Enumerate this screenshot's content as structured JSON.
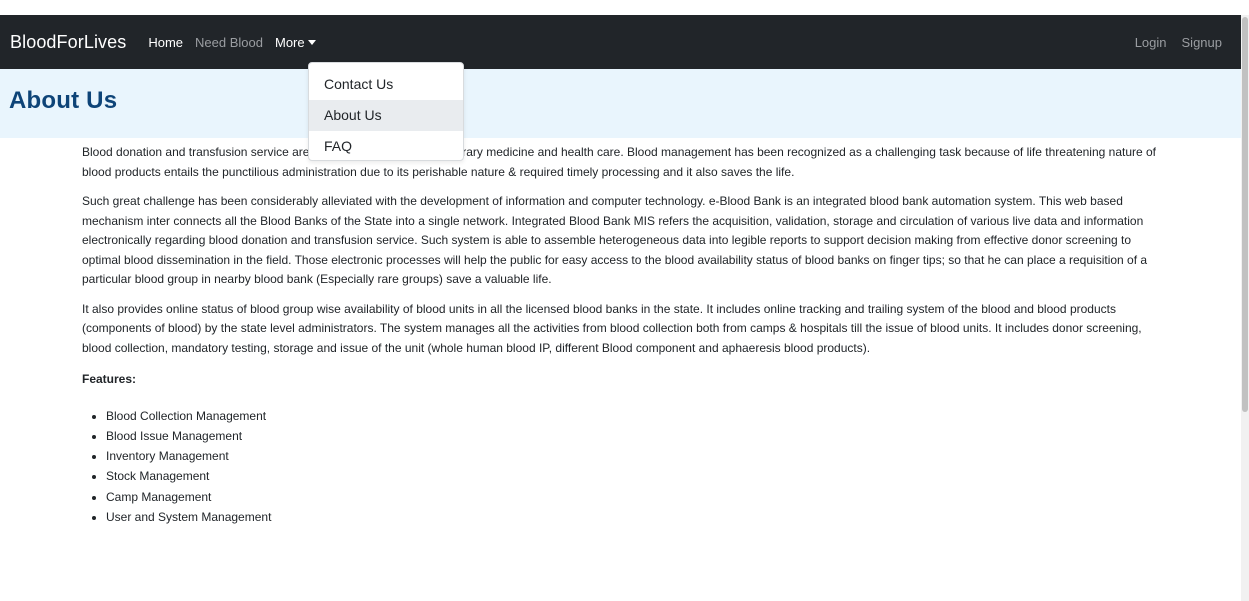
{
  "navbar": {
    "brand": "BloodForLives",
    "home": "Home",
    "need_blood": "Need Blood",
    "more": "More",
    "login": "Login",
    "signup": "Signup"
  },
  "dropdown": {
    "items": [
      "Contact Us",
      "About Us",
      "FAQ"
    ],
    "active": "About Us"
  },
  "page": {
    "title": "About Us",
    "paragraphs": [
      "Blood donation and transfusion service are an integral part of contemporary medicine and health care. Blood management has been recognized as a challenging task because of life threatening nature of blood products entails the punctilious administration due to its perishable nature & required timely processing and it also saves the life.",
      "Such great challenge has been considerably alleviated with the development of information and computer technology. e-Blood Bank is an integrated blood bank automation system. This web based mechanism inter connects all the Blood Banks of the State into a single network. Integrated Blood Bank MIS refers the acquisition, validation, storage and circulation of various live data and information electronically regarding blood donation and transfusion service. Such system is able to assemble heterogeneous data into legible reports to support decision making from effective donor screening to optimal blood dissemination in the field. Those electronic processes will help the public for easy access to the blood availability status of blood banks on finger tips; so that he can place a requisition of a particular blood group in nearby blood bank (Especially rare groups) save a valuable life.",
      "It also provides online status of blood group wise availability of blood units in all the licensed blood banks in the state. It includes online tracking and trailing system of the blood and blood products (components of blood) by the state level administrators. The system manages all the activities from blood collection both from camps & hospitals till the issue of blood units. It includes donor screening, blood collection, mandatory testing, storage and issue of the unit (whole human blood IP, different Blood component and aphaeresis blood products)."
    ],
    "features_title": "Features:",
    "features": [
      "Blood Collection Management",
      "Blood Issue Management",
      "Inventory Management",
      "Stock Management",
      "Camp Management",
      "User and System Management"
    ]
  },
  "colors": {
    "navbar_bg": "#212529",
    "header_bg": "#e9f5fd",
    "title_color": "#0e4478"
  }
}
